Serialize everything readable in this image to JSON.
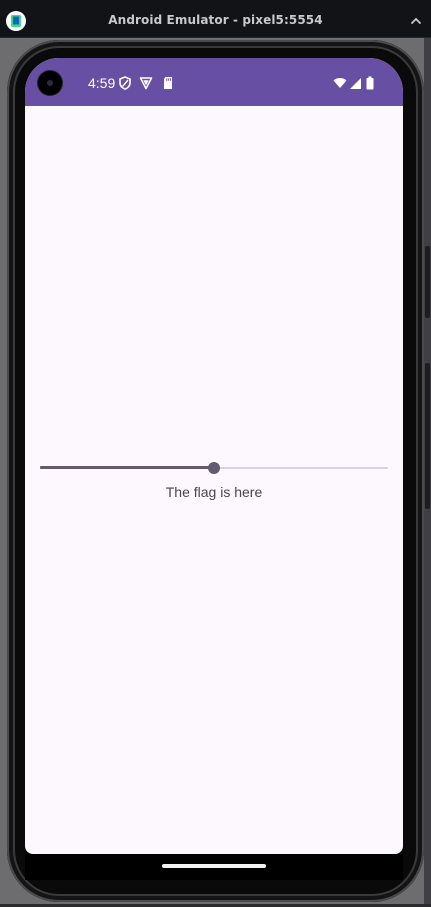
{
  "window": {
    "title": "Android Emulator - pixel5:5554"
  },
  "statusbar": {
    "time": "4:59",
    "left_icons": [
      "shield-icon",
      "play-protect-icon",
      "sd-card-icon"
    ],
    "right_icons": [
      "wifi-icon",
      "cell-signal-icon",
      "battery-icon"
    ],
    "color": "#6750a4"
  },
  "main": {
    "slider": {
      "value": 0.5
    },
    "flag_text": "The flag is here"
  },
  "colors": {
    "background": "#fdf7fe",
    "slider_active": "#625b71",
    "slider_inactive": "#d8d0e3"
  }
}
